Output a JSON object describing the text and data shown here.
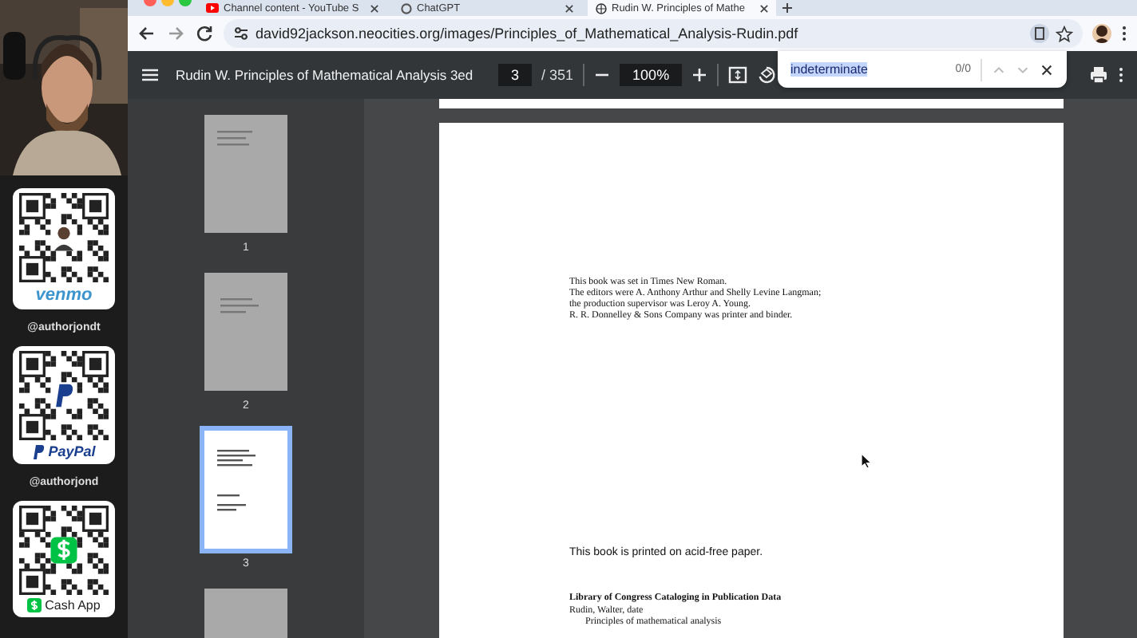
{
  "donation_cards": [
    {
      "kind": "venmo",
      "label": "venmo",
      "handle": "@authorjondt"
    },
    {
      "kind": "paypal",
      "label": "PayPal",
      "handle": "@authorjond"
    },
    {
      "kind": "cashapp",
      "label": "Cash App"
    }
  ],
  "browser": {
    "tabs": [
      {
        "title": "Channel content - YouTube S",
        "kind": "youtube",
        "selected": false
      },
      {
        "title": "ChatGPT",
        "kind": "chatgpt",
        "selected": false
      },
      {
        "title": "Rudin W. Principles of Mathe",
        "kind": "globe",
        "selected": true
      }
    ],
    "url": "david92jackson.neocities.org/images/Principles_of_Mathematical_Analysis-Rudin.pdf"
  },
  "pdf_toolbar": {
    "title": "Rudin W. Principles of Mathematical Analysis 3ed",
    "page": "3",
    "page_count": "/ 351",
    "zoom": "100%"
  },
  "find_bar": {
    "query": "indeterminate",
    "count": "0/0"
  },
  "thumbnails": [
    {
      "label": "1",
      "selected": false
    },
    {
      "label": "2",
      "selected": false
    },
    {
      "label": "3",
      "selected": true
    },
    {
      "selected": false
    }
  ],
  "page": {
    "colophon": [
      "This book was set in Times New Roman.",
      "The editors were A. Anthony Arthur and Shelly Levine Langman;",
      "the production supervisor was Leroy A. Young.",
      "R. R. Donnelley & Sons Company was printer and binder."
    ],
    "paper_note": "This book is printed on acid-free paper.",
    "cip_heading": "Library of Congress Cataloging in Publication Data",
    "cip_lines": [
      "Rudin, Walter, date",
      "Principles of mathematical analysis"
    ]
  }
}
